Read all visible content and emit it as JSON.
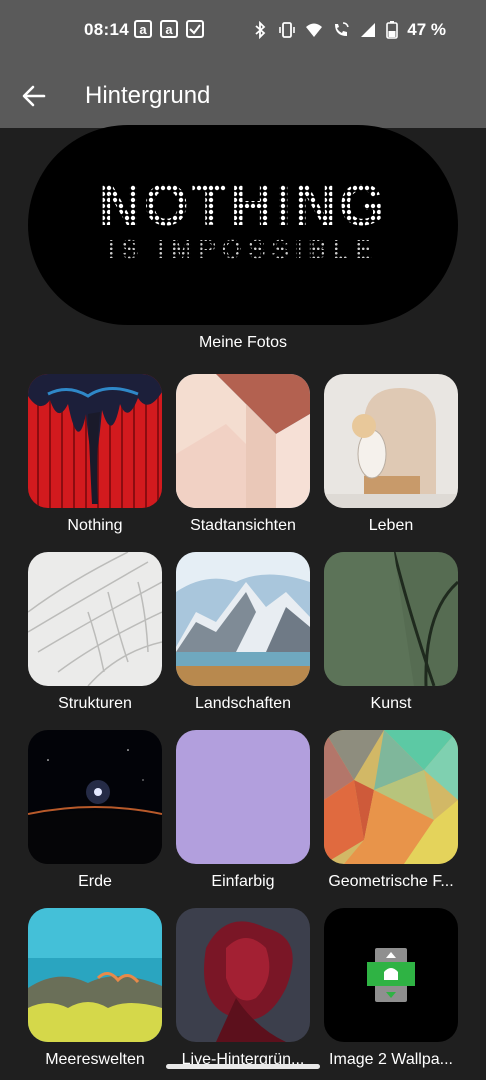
{
  "status_bar": {
    "time": "08:14",
    "battery_percent": "47 %",
    "left_icons": [
      "amazon-a-icon",
      "amazon-a-icon",
      "checkbox-icon"
    ],
    "right_icons": [
      "bluetooth-icon",
      "vibrate-icon",
      "wifi-icon",
      "wifi-call-icon",
      "signal-icon",
      "battery-icon"
    ]
  },
  "app_bar": {
    "title": "Hintergrund"
  },
  "banner": {
    "line1": "NOTHING",
    "line2": "IS IMPOSSIBLE",
    "label": "Meine Fotos"
  },
  "categories": [
    {
      "label": "Nothing"
    },
    {
      "label": "Stadtansichten"
    },
    {
      "label": "Leben"
    },
    {
      "label": "Strukturen"
    },
    {
      "label": "Landschaften"
    },
    {
      "label": "Kunst"
    },
    {
      "label": "Erde"
    },
    {
      "label": "Einfarbig"
    },
    {
      "label": "Geometrische F..."
    },
    {
      "label": "Meereswelten"
    },
    {
      "label": "Live-Hintergrün..."
    },
    {
      "label": "Image 2 Wallpa..."
    }
  ],
  "colors": {
    "appbar": "#5a5a5a",
    "background": "#1f1f1f",
    "solid_tile": "#b29fdd"
  }
}
